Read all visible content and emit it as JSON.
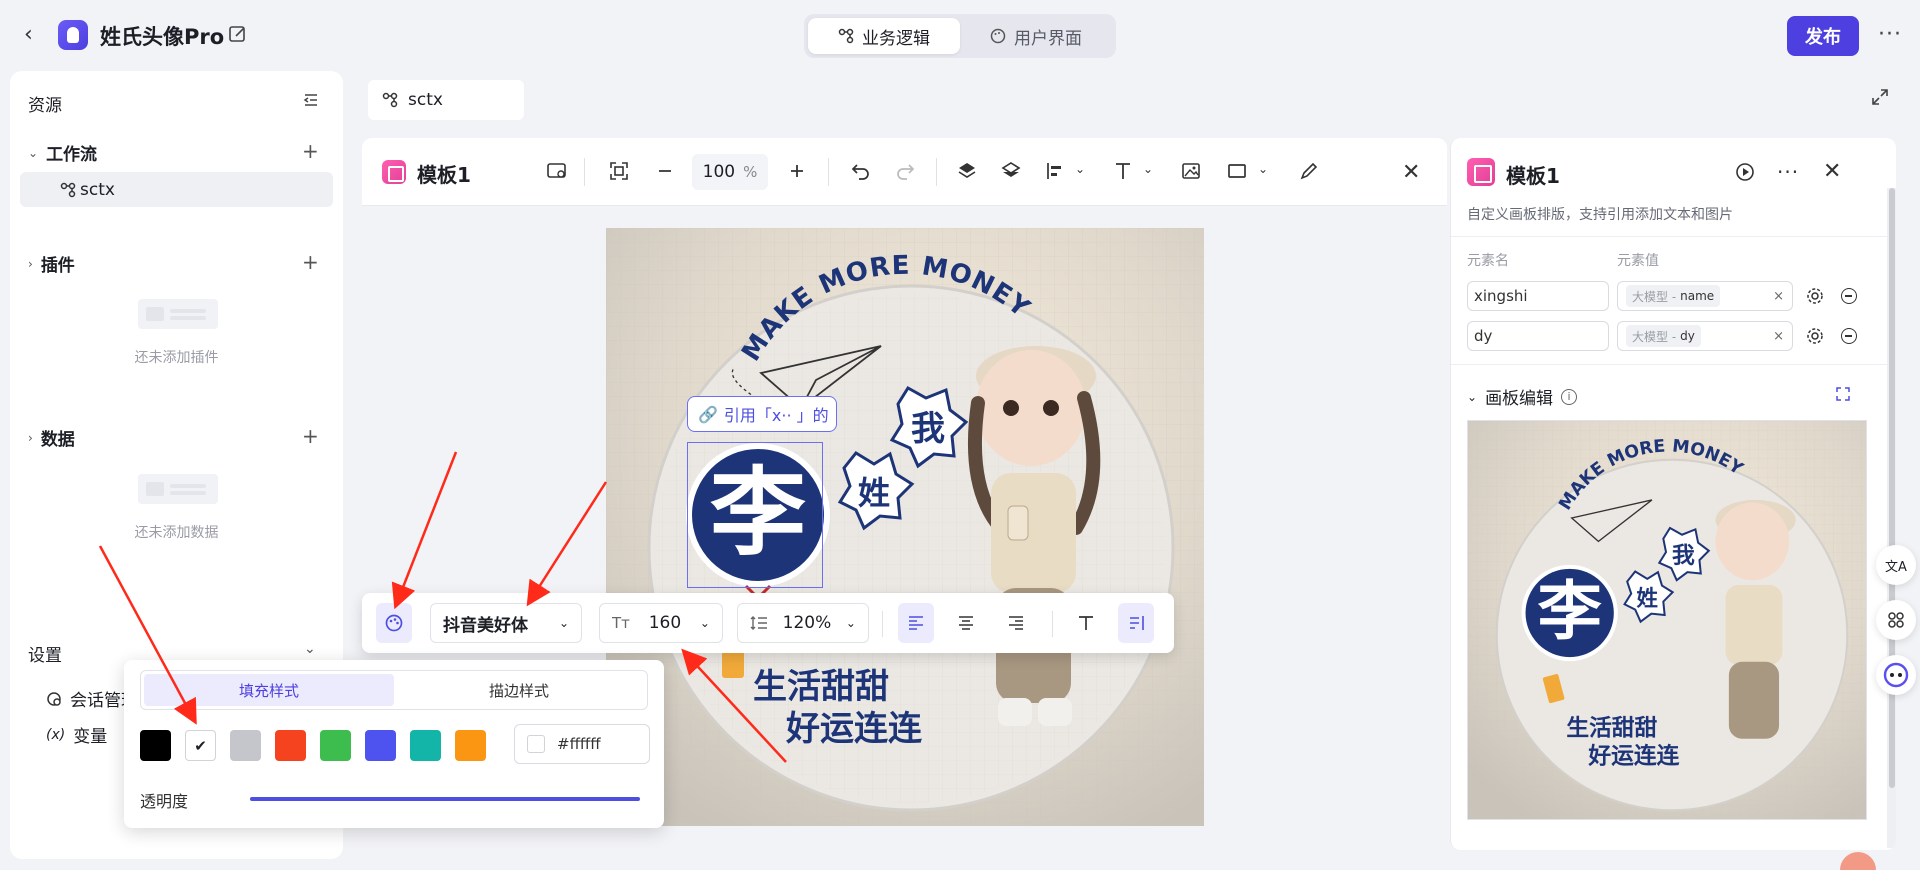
{
  "header": {
    "app_title": "姓氏头像Pro",
    "tabs": [
      {
        "label": "业务逻辑",
        "active": true
      },
      {
        "label": "用户界面",
        "active": false
      }
    ],
    "publish_label": "发布",
    "more_label": "···"
  },
  "sidebar": {
    "title": "资源",
    "sections": {
      "workflow": {
        "label": "工作流",
        "items": [
          "sctx"
        ]
      },
      "plugins": {
        "label": "插件",
        "empty_text": "还未添加插件"
      },
      "data": {
        "label": "数据",
        "empty_text": "还未添加数据"
      }
    },
    "settings": {
      "label": "设置",
      "items": [
        "会话管理",
        "变量"
      ]
    }
  },
  "doc_tab": {
    "label": "sctx"
  },
  "editor": {
    "title": "模板1",
    "zoom_value": "100",
    "zoom_unit": "%"
  },
  "poster": {
    "arc_text": "MAKE MORE MONEY",
    "big_char": "李",
    "star1": "我",
    "star2": "姓",
    "ref_chip": "引用「x·· 」的",
    "line1": "生活甜甜",
    "line2": "好运连连"
  },
  "text_toolbar": {
    "font": "抖音美好体",
    "size": "160",
    "line_height": "120%"
  },
  "fill_popover": {
    "tabs": [
      "填充样式",
      "描边样式"
    ],
    "active_tab": 0,
    "swatches": [
      "#000000",
      "#ffffff",
      "#c4c6cc",
      "#f5421f",
      "#3dbd4e",
      "#4e52ee",
      "#12b5a8",
      "#fa9612"
    ],
    "selected_swatch": 1,
    "hex_value": "#ffffff",
    "opacity_label": "透明度",
    "opacity": 1.0
  },
  "right_panel": {
    "title": "模板1",
    "description": "自定义画板排版，支持引用添加文本和图片",
    "col_name": "元素名",
    "col_value": "元素值",
    "elements": [
      {
        "name": "xingshi",
        "prefix": "大模型 -",
        "value": "name"
      },
      {
        "name": "dy",
        "prefix": "大模型 -",
        "value": "dy"
      }
    ],
    "canvas_section": "画板编辑"
  },
  "colors": {
    "accent": "#4d3fe0",
    "navy": "#1d3578",
    "annotation": "#ff2a1a"
  }
}
